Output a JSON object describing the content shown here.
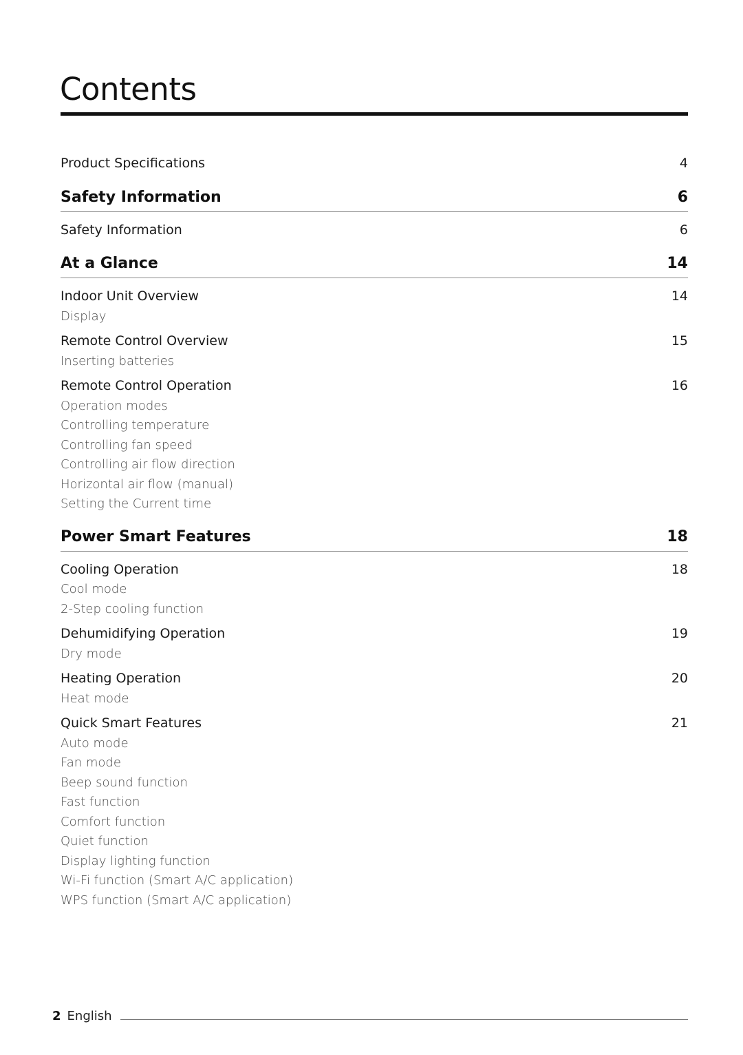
{
  "title": "Contents",
  "toc": {
    "intro": {
      "label": "Product Specifications",
      "page": "4"
    },
    "sections": [
      {
        "label": "Safety Information",
        "page": "6",
        "entries": [
          {
            "label": "Safety Information",
            "page": "6",
            "subitems": []
          }
        ]
      },
      {
        "label": "At a Glance",
        "page": "14",
        "entries": [
          {
            "label": "Indoor Unit Overview",
            "page": "14",
            "subitems": [
              "Display"
            ]
          },
          {
            "label": "Remote Control Overview",
            "page": "15",
            "subitems": [
              "Inserting batteries"
            ]
          },
          {
            "label": "Remote Control Operation",
            "page": "16",
            "subitems": [
              "Operation modes",
              "Controlling temperature",
              "Controlling fan speed",
              "Controlling air flow direction",
              "Horizontal air flow (manual)",
              "Setting the Current time"
            ]
          }
        ]
      },
      {
        "label": "Power Smart Features",
        "page": "18",
        "entries": [
          {
            "label": "Cooling Operation",
            "page": "18",
            "subitems": [
              "Cool mode",
              "2-Step cooling function"
            ]
          },
          {
            "label": "Dehumidifying Operation",
            "page": "19",
            "subitems": [
              "Dry mode"
            ]
          },
          {
            "label": "Heating Operation",
            "page": "20",
            "subitems": [
              "Heat mode"
            ]
          },
          {
            "label": "Quick Smart Features",
            "page": "21",
            "subitems": [
              "Auto mode",
              "Fan mode",
              "Beep sound function",
              "Fast function",
              "Comfort function",
              "Quiet function",
              "Display lighting function",
              "Wi-Fi function (Smart A/C application)",
              "WPS function (Smart A/C application)"
            ]
          }
        ]
      }
    ]
  },
  "footer": {
    "page_number": "2",
    "language": "English"
  }
}
